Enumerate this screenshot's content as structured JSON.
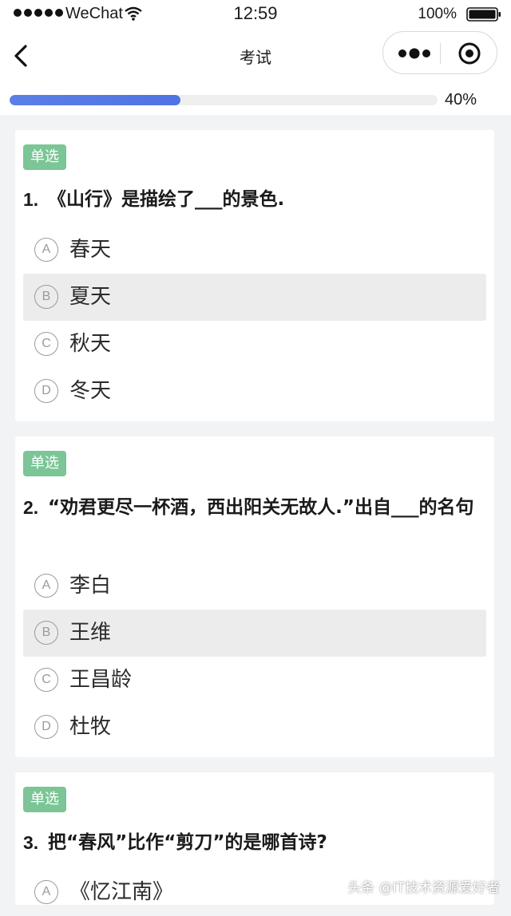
{
  "status_bar": {
    "carrier": "WeChat",
    "time": "12:59",
    "battery": "100%"
  },
  "nav": {
    "title": "考试",
    "icons": [
      "back-icon",
      "more-icon",
      "close-icon"
    ]
  },
  "progress": {
    "percent_label": "40%",
    "value": 0.4,
    "color": "#5a7fe6"
  },
  "colors": {
    "tag": "#7bc596",
    "selected_option": "#ececec",
    "background": "#f2f3f5"
  },
  "questions": [
    {
      "tag": "单选",
      "number": "1.",
      "text": "《山行》是描绘了___的景色.",
      "options": [
        {
          "letter": "A",
          "label": "春天",
          "selected": false
        },
        {
          "letter": "B",
          "label": "夏天",
          "selected": true
        },
        {
          "letter": "C",
          "label": "秋天",
          "selected": false
        },
        {
          "letter": "D",
          "label": "冬天",
          "selected": false
        }
      ]
    },
    {
      "tag": "单选",
      "number": "2.",
      "text": "“劝君更尽一杯酒，西出阳关无故人.”出自___的名句",
      "options": [
        {
          "letter": "A",
          "label": "李白",
          "selected": false
        },
        {
          "letter": "B",
          "label": "王维",
          "selected": true
        },
        {
          "letter": "C",
          "label": "王昌龄",
          "selected": false
        },
        {
          "letter": "D",
          "label": "杜牧",
          "selected": false
        }
      ]
    },
    {
      "tag": "单选",
      "number": "3.",
      "text": "把“春风”比作“剪刀”的是哪首诗?",
      "options": [
        {
          "letter": "A",
          "label": "《忆江南》",
          "selected": false
        }
      ]
    }
  ],
  "watermark": "头条 @IT技术资源爱好者"
}
